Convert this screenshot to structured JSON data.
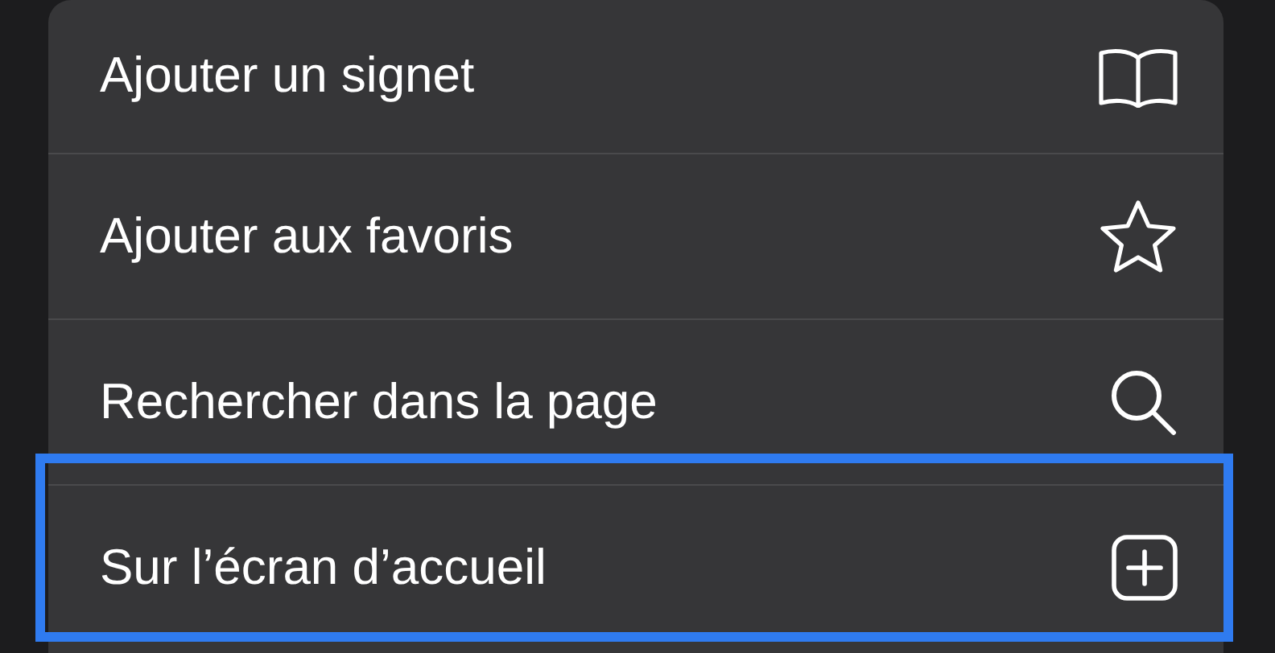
{
  "menu": {
    "items": [
      {
        "label": "Ajouter un signet",
        "kind": "book",
        "highlighted": false
      },
      {
        "label": "Ajouter aux favoris",
        "kind": "star",
        "highlighted": false
      },
      {
        "label": "Rechercher dans la page",
        "kind": "search",
        "highlighted": false
      },
      {
        "label": "Sur l’écran d’accueil",
        "kind": "add",
        "highlighted": true
      }
    ]
  }
}
